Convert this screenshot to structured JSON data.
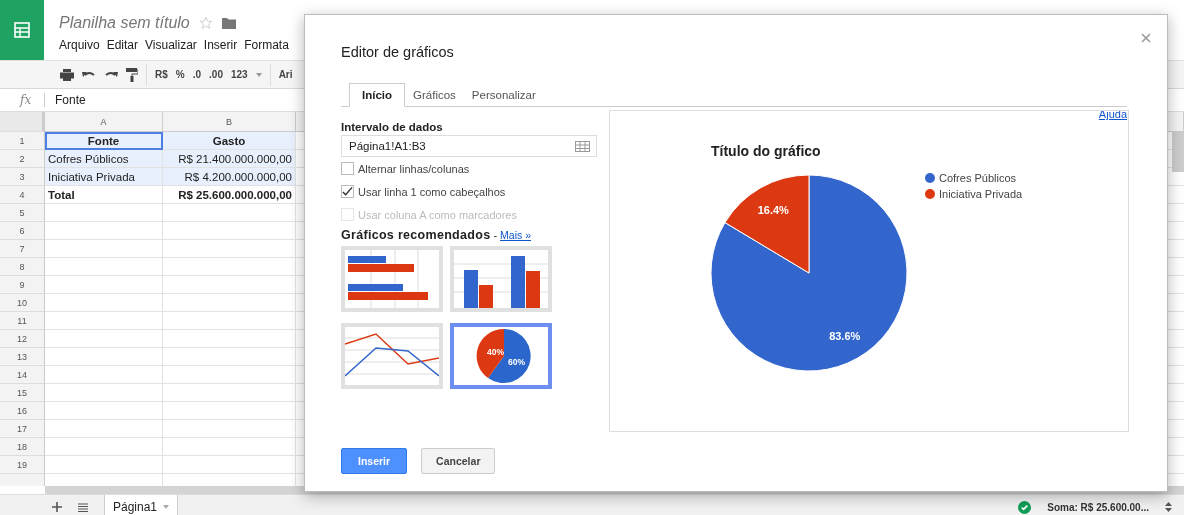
{
  "app": {
    "title": "Planilha sem título",
    "menu": [
      "Arquivo",
      "Editar",
      "Visualizar",
      "Inserir",
      "Formata"
    ]
  },
  "toolbar": {
    "format_buttons": [
      "R$",
      "%",
      ".0",
      ".00",
      "123"
    ],
    "font": "Ari"
  },
  "formula_bar": {
    "label": "fx",
    "value": "Fonte"
  },
  "sheet": {
    "columns": [
      "A",
      "B"
    ],
    "rows": [
      {
        "number": "1",
        "kind": "header",
        "selected": true,
        "cells": [
          "Fonte",
          "Gasto"
        ]
      },
      {
        "number": "2",
        "kind": "data",
        "selected": true,
        "cells": [
          "Cofres Públicos",
          "R$ 21.400.000.000,00"
        ]
      },
      {
        "number": "3",
        "kind": "data",
        "selected": true,
        "cells": [
          "Iniciativa Privada",
          "R$ 4.200.000.000,00"
        ]
      },
      {
        "number": "4",
        "kind": "total",
        "selected": false,
        "cells": [
          "Total",
          "R$ 25.600.000.000,00"
        ]
      }
    ],
    "empty_rows": [
      "5",
      "6",
      "7",
      "8",
      "9",
      "10",
      "11",
      "12",
      "13",
      "14",
      "15",
      "16",
      "17",
      "18",
      "19"
    ]
  },
  "sheet_tabs": [
    {
      "label": "Página1",
      "selected": true
    }
  ],
  "status": {
    "sum": "Soma: R$ 25.600.00..."
  },
  "dialog": {
    "title": "Editor de gráficos",
    "help": "Ajuda",
    "tabs": [
      {
        "label": "Início",
        "selected": true
      },
      {
        "label": "Gráficos",
        "selected": false
      },
      {
        "label": "Personalizar",
        "selected": false
      }
    ],
    "range_label": "Intervalo de dados",
    "range_value": "Página1!A1:B3",
    "options": [
      {
        "label": "Alternar linhas/colunas",
        "checked": false,
        "disabled": false
      },
      {
        "label": "Usar linha 1 como cabeçalhos",
        "checked": true,
        "disabled": false
      },
      {
        "label": "Usar coluna A como marcadores",
        "checked": false,
        "disabled": true
      }
    ],
    "recommended_title": "Gráficos recomendados",
    "more_separator": "-",
    "more_link": "Mais »",
    "thumbnails": [
      {
        "kind": "bar",
        "selected": false
      },
      {
        "kind": "column",
        "selected": false
      },
      {
        "kind": "line",
        "selected": false
      },
      {
        "kind": "pie",
        "selected": true,
        "labels": [
          "40%",
          "60%"
        ]
      }
    ],
    "chart": {
      "chart_data": {
        "type": "pie",
        "title": "Título do gráfico",
        "categories": [
          "Cofres Públicos",
          "Iniciativa Privada"
        ],
        "values": [
          83.6,
          16.4
        ],
        "value_labels": [
          "83.6%",
          "16.4%"
        ],
        "legend": "right"
      },
      "slice_colors": [
        {
          "color": "#3366cc"
        },
        {
          "color": "#dc3912"
        }
      ]
    },
    "buttons": [
      {
        "label": "Inserir",
        "kind": "primary"
      },
      {
        "label": "Cancelar",
        "kind": "secondary"
      }
    ]
  }
}
